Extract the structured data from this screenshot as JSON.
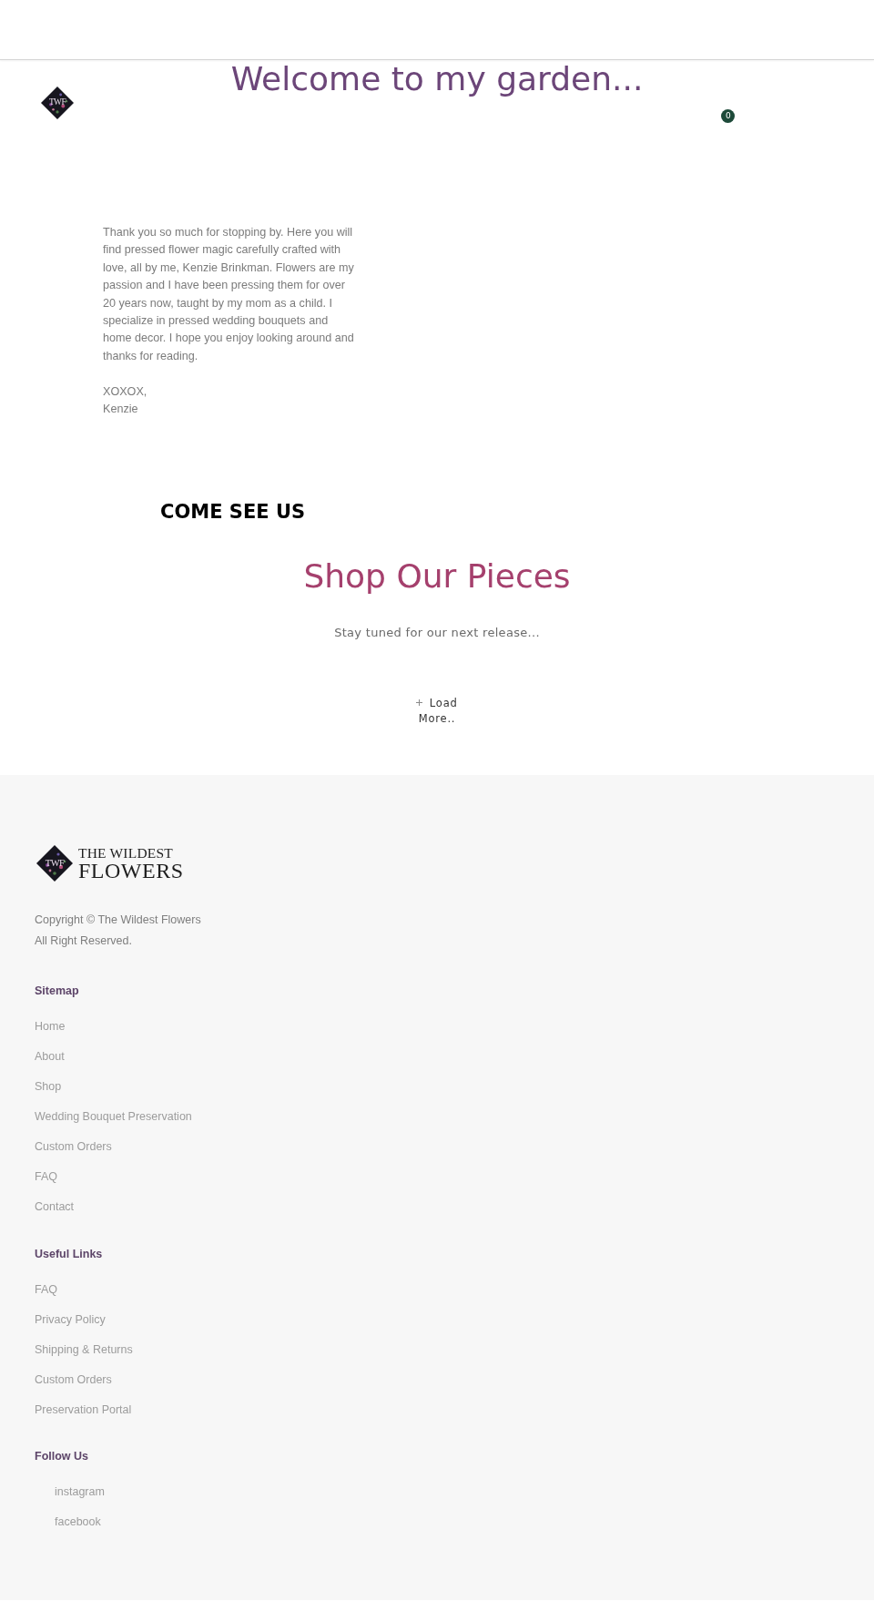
{
  "header": {
    "logo": {
      "monogram": "TWF"
    },
    "title": "Welcome to my garden...",
    "cart": {
      "count": "0"
    }
  },
  "intro": {
    "paragraph": "Thank you so much for stopping by. Here you will find pressed flower magic carefully crafted with love, all by me, Kenzie Brinkman. Flowers are my passion and I have been pressing them for over 20 years now, taught by my mom as a child. I specialize in pressed wedding bouquets and home decor. I hope you enjoy looking around and thanks for reading.",
    "signoff": [
      "XOXOX,",
      "Kenzie"
    ]
  },
  "visit": {
    "heading": "COME SEE US"
  },
  "shop": {
    "heading": "Shop Our Pieces",
    "message": "Stay tuned for our next release...",
    "load_more": {
      "label": "Load More.."
    }
  },
  "footer": {
    "logo": {
      "monogram": "TWF",
      "name_top": "THE WILDEST",
      "name_bottom": "FLOWERS"
    },
    "copyright": [
      "Copyright © The Wildest Flowers",
      "All Right Reserved."
    ],
    "sections": [
      {
        "title": "Sitemap",
        "kind": "links",
        "links": [
          "Home",
          "About",
          "Shop",
          "Wedding Bouquet Preservation",
          "Custom Orders",
          "FAQ",
          "Contact"
        ]
      },
      {
        "title": "Useful Links",
        "kind": "links",
        "links": [
          "FAQ",
          "Privacy Policy",
          "Shipping & Returns",
          "Custom Orders",
          "Preservation Portal"
        ]
      },
      {
        "title": "Follow Us",
        "kind": "social",
        "links": [
          "instagram",
          "facebook"
        ]
      }
    ]
  }
}
